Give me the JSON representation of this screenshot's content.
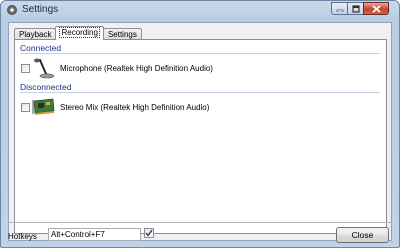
{
  "window": {
    "title": "Settings",
    "controls": {
      "minimize_icon": "minimize-icon",
      "maximize_icon": "maximize-icon",
      "close_icon": "close-icon"
    }
  },
  "tabs": [
    {
      "label": "Playback",
      "active": false
    },
    {
      "label": "Recording",
      "active": true
    },
    {
      "label": "Settings",
      "active": false
    }
  ],
  "groups": {
    "connected": {
      "header": "Connected",
      "devices": [
        {
          "label": "Microphone (Realtek High Definition Audio)",
          "icon": "microphone-icon",
          "checked": false
        }
      ]
    },
    "disconnected": {
      "header": "Disconnected",
      "devices": [
        {
          "label": "Stereo Mix (Realtek High Definition Audio)",
          "icon": "sound-card-icon",
          "checked": false
        }
      ]
    }
  },
  "footer": {
    "hotkeys_label": "Hotkeys",
    "hotkeys_value": "Alt+Control+F7",
    "hotkeys_enabled": true,
    "close_label": "Close"
  },
  "colors": {
    "group_header": "#1e3287",
    "title_bar": "#b8cce4",
    "close_button_red": "#c2472e"
  }
}
